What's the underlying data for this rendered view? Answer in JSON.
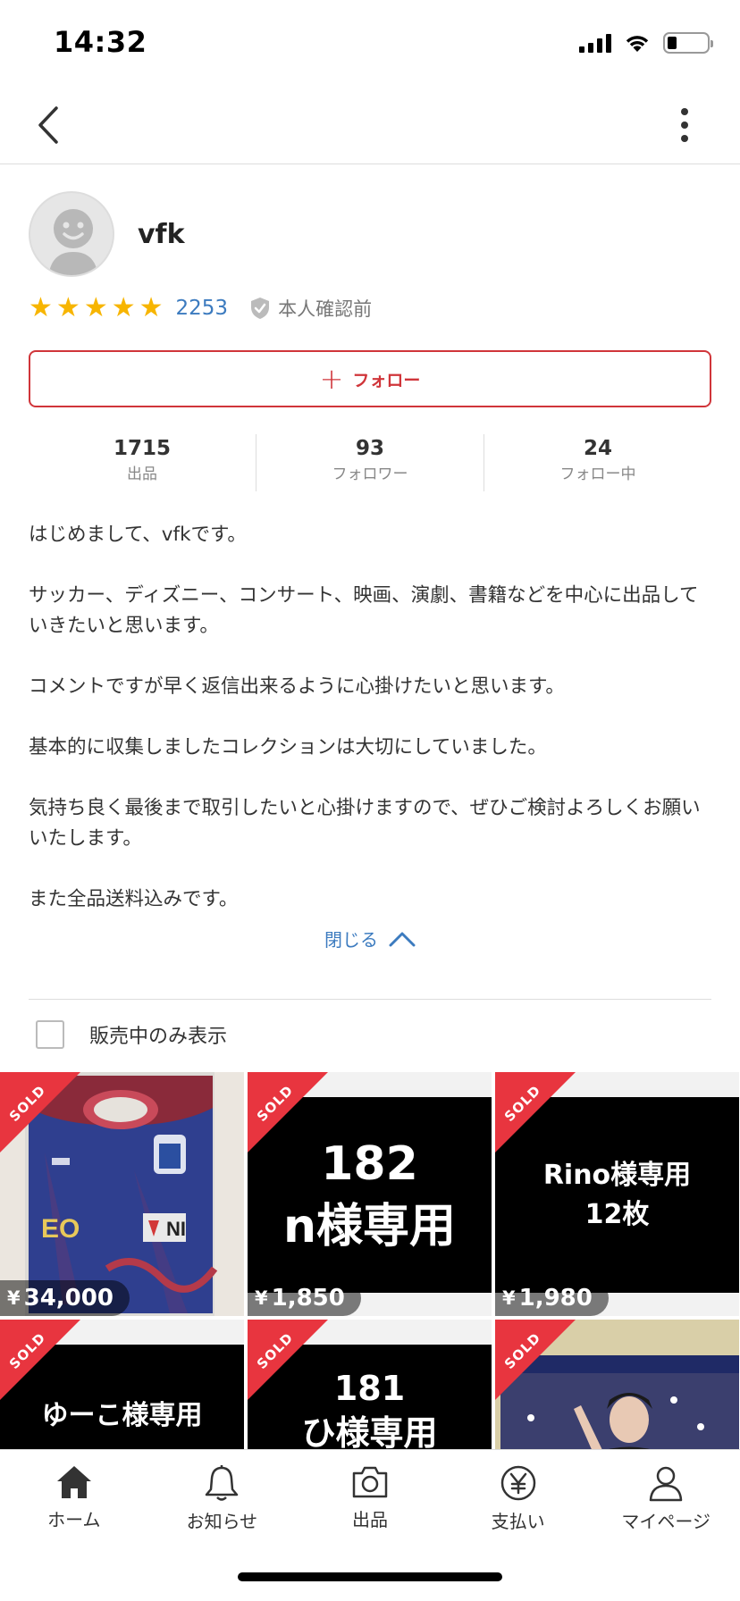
{
  "status_bar": {
    "time": "14:32"
  },
  "nav": {
    "back_icon": "chevron-left-icon",
    "more_icon": "more-vertical-icon"
  },
  "profile": {
    "username": "vfk",
    "rating_stars": 5,
    "rating_count": "2253",
    "verification_status": "本人確認前",
    "follow_label": "フォロー",
    "stats": [
      {
        "value": "1715",
        "label": "出品"
      },
      {
        "value": "93",
        "label": "フォロワー"
      },
      {
        "value": "24",
        "label": "フォロー中"
      }
    ],
    "bio": "はじめまして、vfkです。\n\nサッカー、ディズニー、コンサート、映画、演劇、書籍などを中心に出品していきたいと思います。\n\nコメントですが早く返信出来るように心掛けたいと思います。\n\n基本的に収集しましたコレクションは大切にしていました。\n\n気持ち良く最後まで取引したいと心掛けますので、ぜひご検討よろしくお願いいたします。\n\nまた全品送料込みです。",
    "collapse_label": "閉じる"
  },
  "filter": {
    "label": "販売中のみ表示",
    "checked": false
  },
  "items": [
    {
      "status": "SOLD",
      "currency": "¥",
      "price": "34,000",
      "image": "soccer-jersey",
      "line1": "",
      "line2": ""
    },
    {
      "status": "SOLD",
      "currency": "¥",
      "price": "1,850",
      "image": "text",
      "line1": "182",
      "line2": "n様専用"
    },
    {
      "status": "SOLD",
      "currency": "¥",
      "price": "1,980",
      "image": "text",
      "line1": "Rino様専用",
      "line2": "12枚"
    },
    {
      "status": "SOLD",
      "currency": "",
      "price": "",
      "image": "text",
      "line1": "",
      "line2": "ゆーこ様専用"
    },
    {
      "status": "SOLD",
      "currency": "",
      "price": "",
      "image": "text",
      "line1": "181",
      "line2": "ひ様専用"
    },
    {
      "status": "SOLD",
      "currency": "",
      "price": "",
      "image": "performer-photo",
      "line1": "",
      "line2": ""
    }
  ],
  "tab_bar": [
    {
      "label": "ホーム",
      "icon": "home-icon"
    },
    {
      "label": "お知らせ",
      "icon": "bell-icon"
    },
    {
      "label": "出品",
      "icon": "camera-icon"
    },
    {
      "label": "支払い",
      "icon": "yen-icon"
    },
    {
      "label": "マイページ",
      "icon": "user-icon"
    }
  ],
  "colors": {
    "accent": "#d0353a",
    "link": "#3c7bbf",
    "star": "#f7b500",
    "sold": "#e8353f"
  }
}
